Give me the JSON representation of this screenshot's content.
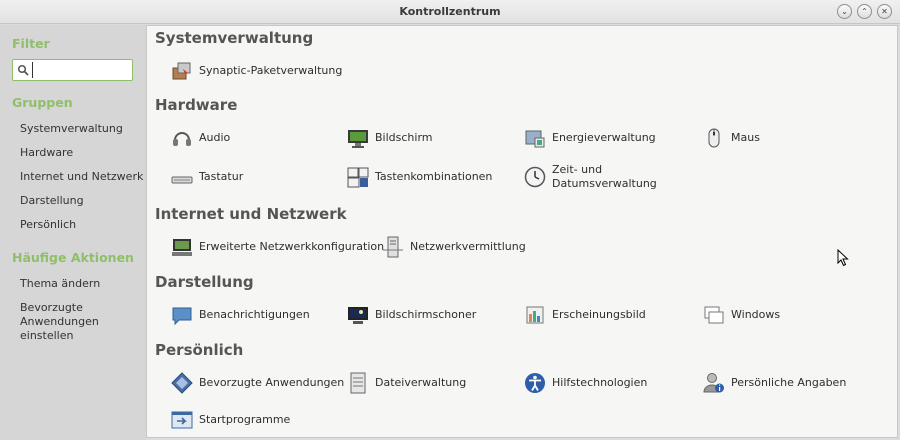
{
  "window": {
    "title": "Kontrollzentrum",
    "buttons": [
      "⌄",
      "⌃",
      "✕"
    ]
  },
  "sidebar": {
    "filter_heading": "Filter",
    "filter_value": "",
    "groups_heading": "Gruppen",
    "groups": [
      "Systemverwaltung",
      "Hardware",
      "Internet und Netzwerk",
      "Darstellung",
      "Persönlich"
    ],
    "actions_heading": "Häufige Aktionen",
    "actions": [
      "Thema ändern",
      "Bevorzugte Anwendungen einstellen"
    ],
    "heading_color": "#8fbf69"
  },
  "categories": [
    {
      "title": "Systemverwaltung",
      "items": [
        {
          "label": "Synaptic-Paketverwaltung",
          "icon": "package-manager-icon"
        }
      ]
    },
    {
      "title": "Hardware",
      "items": [
        {
          "label": "Audio",
          "icon": "headphones-icon"
        },
        {
          "label": "Bildschirm",
          "icon": "monitor-icon"
        },
        {
          "label": "Energieverwaltung",
          "icon": "power-management-icon"
        },
        {
          "label": "Maus",
          "icon": "mouse-icon"
        },
        {
          "label": "Tastatur",
          "icon": "keyboard-icon"
        },
        {
          "label": "Tastenkombinationen",
          "icon": "keyboard-shortcuts-icon"
        },
        {
          "label": "Zeit- und Datumsverwaltung",
          "icon": "clock-icon"
        }
      ]
    },
    {
      "title": "Internet und Netzwerk",
      "items": [
        {
          "label": "Erweiterte Netzwerkkonfiguration",
          "icon": "network-config-icon"
        },
        {
          "label": "Netzwerkvermittlung",
          "icon": "proxy-server-icon"
        }
      ]
    },
    {
      "title": "Darstellung",
      "items": [
        {
          "label": "Benachrichtigungen",
          "icon": "notification-icon"
        },
        {
          "label": "Bildschirmschoner",
          "icon": "screensaver-icon"
        },
        {
          "label": "Erscheinungsbild",
          "icon": "appearance-icon"
        },
        {
          "label": "Windows",
          "icon": "windows-icon"
        }
      ]
    },
    {
      "title": "Persönlich",
      "items": [
        {
          "label": "Bevorzugte Anwendungen",
          "icon": "preferred-apps-icon"
        },
        {
          "label": "Dateiverwaltung",
          "icon": "file-manager-icon"
        },
        {
          "label": "Hilfstechnologien",
          "icon": "accessibility-icon"
        },
        {
          "label": "Persönliche Angaben",
          "icon": "user-info-icon"
        },
        {
          "label": "Startprogramme",
          "icon": "startup-apps-icon"
        }
      ]
    }
  ]
}
